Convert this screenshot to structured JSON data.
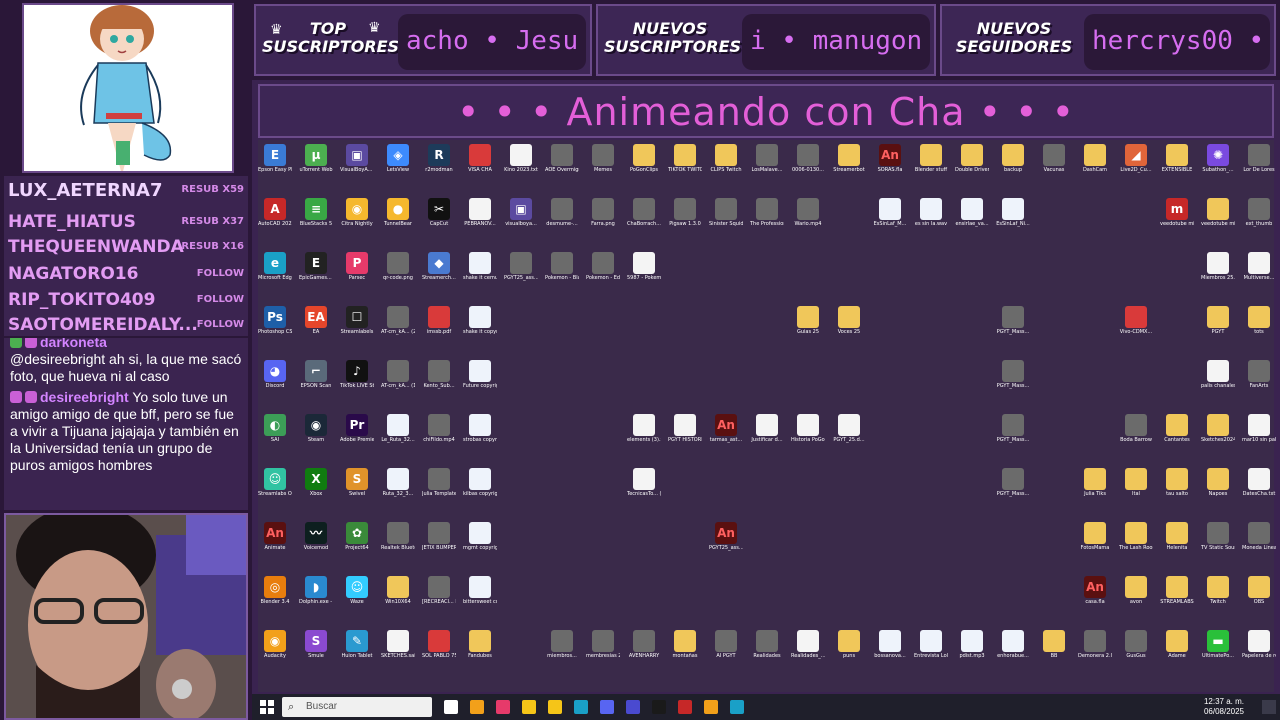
{
  "top_subscribers": {
    "title": "TOP SUSCRIPTORES",
    "ticker": "acho • Jesu"
  },
  "new_subscribers": {
    "title": "NUEVOS SUSCRIPTORES",
    "ticker": "i • manugon"
  },
  "new_followers": {
    "title": "NUEVOS SEGUIDORES",
    "ticker": "hercrys00 •"
  },
  "banner": {
    "title": "• • • Animeando con Cha • • •"
  },
  "subs": [
    {
      "name": "LUX_AETERNA7",
      "tag": "RESUB X59"
    },
    {
      "name": "HATE_HIATUS",
      "tag": "RESUB X37"
    },
    {
      "name": "THEQUEENWANDA",
      "tag": "RESUB X16"
    },
    {
      "name": "NAGATORO16",
      "tag": "FOLLOW"
    },
    {
      "name": "RIP_TOKITO409",
      "tag": "FOLLOW"
    },
    {
      "name": "SAOTOMEREIDALY...",
      "tag": "FOLLOW"
    }
  ],
  "chat": [
    {
      "user": "darkoneta",
      "text": ""
    },
    {
      "user": "",
      "text": "@desireebright ah si, la que me sacó foto, que hueva ni al caso"
    },
    {
      "user": "desireebright",
      "text": "Yo solo tuve un amigo amigo de que bff, pero se fue a vivir a Tijuana jajajaja y también en la Universidad tenía un grupo de puros amigos hombres"
    }
  ],
  "desktop": {
    "icons": [
      {
        "label": "Epson Easy Photo Print",
        "kind": "app",
        "color": "#3a7bd5",
        "glyph": "E"
      },
      {
        "label": "uTorrent Web",
        "kind": "app",
        "color": "#4caf50",
        "glyph": "µ"
      },
      {
        "label": "VisualBoyA... - Acceso di...",
        "kind": "app",
        "color": "#5b4aa0",
        "glyph": "▣"
      },
      {
        "label": "LetsView",
        "kind": "app",
        "color": "#3d8bfd",
        "glyph": "◈"
      },
      {
        "label": "r2modman",
        "kind": "app",
        "color": "#1d3b5a",
        "glyph": "R"
      },
      {
        "label": "VISA CHA",
        "kind": "doc-pdf",
        "color": "",
        "glyph": ""
      },
      {
        "label": "Kino 2023.txt",
        "kind": "doc",
        "color": "",
        "glyph": ""
      },
      {
        "label": "AOE Overmign_...",
        "kind": "pic",
        "color": "",
        "glyph": ""
      },
      {
        "label": "Memes",
        "kind": "pic",
        "color": "",
        "glyph": ""
      },
      {
        "label": "PoGonClips",
        "kind": "folder",
        "color": "",
        "glyph": ""
      },
      {
        "label": "TIKTOK TWITCH",
        "kind": "folder",
        "color": "",
        "glyph": ""
      },
      {
        "label": "CLIPS Twitch",
        "kind": "folder",
        "color": "",
        "glyph": ""
      },
      {
        "label": "LosMalave...",
        "kind": "pic",
        "color": "",
        "glyph": ""
      },
      {
        "label": "0006-0130...",
        "kind": "pic",
        "color": "",
        "glyph": ""
      },
      {
        "label": "Streamerbot",
        "kind": "folder",
        "color": "",
        "glyph": ""
      },
      {
        "label": "SORAS.fla",
        "kind": "an",
        "color": "",
        "glyph": "An"
      },
      {
        "label": "Blender stuff",
        "kind": "folder",
        "color": "",
        "glyph": ""
      },
      {
        "label": "Double Driver",
        "kind": "folder",
        "color": "",
        "glyph": ""
      },
      {
        "label": "backup",
        "kind": "folder",
        "color": "",
        "glyph": ""
      },
      {
        "label": "Vacunas",
        "kind": "pic",
        "color": "",
        "glyph": ""
      },
      {
        "label": "DashCam",
        "kind": "folder",
        "color": "",
        "glyph": ""
      },
      {
        "label": "Live2D_Cu...",
        "kind": "app",
        "color": "#e0653a",
        "glyph": "◢"
      },
      {
        "label": "EXTENSIBLE",
        "kind": "folder",
        "color": "",
        "glyph": ""
      },
      {
        "label": "Subathon_...",
        "kind": "app",
        "color": "#7a4ae0",
        "glyph": "✺"
      },
      {
        "label": "Lor De Lores",
        "kind": "pic",
        "color": "",
        "glyph": ""
      },
      {
        "label": "AutoCAD 2022 - E...",
        "kind": "app",
        "color": "#c62828",
        "glyph": "A"
      },
      {
        "label": "BlueStacks 5",
        "kind": "app",
        "color": "#39a845",
        "glyph": "≡"
      },
      {
        "label": "Citra Nightly",
        "kind": "app",
        "color": "#f5b82e",
        "glyph": "◉"
      },
      {
        "label": "TunnelBear",
        "kind": "app",
        "color": "#f5b82e",
        "glyph": "●"
      },
      {
        "label": "CapCut",
        "kind": "app",
        "color": "#111111",
        "glyph": "✂"
      },
      {
        "label": "PEBRANOV...",
        "kind": "doc",
        "color": "",
        "glyph": ""
      },
      {
        "label": "visualboya...",
        "kind": "app",
        "color": "#5b4aa0",
        "glyph": "▣"
      },
      {
        "label": "desmume-...",
        "kind": "pic",
        "color": "",
        "glyph": ""
      },
      {
        "label": "Farra.png",
        "kind": "pic",
        "color": "",
        "glyph": ""
      },
      {
        "label": "ChaBorrach...",
        "kind": "pic",
        "color": "",
        "glyph": ""
      },
      {
        "label": "Pigsaw 1.3.0",
        "kind": "pic",
        "color": "",
        "glyph": ""
      },
      {
        "label": "Sinister Squidwa...",
        "kind": "pic",
        "color": "",
        "glyph": ""
      },
      {
        "label": "The Professional",
        "kind": "pic",
        "color": "",
        "glyph": ""
      },
      {
        "label": "Wario.mp4",
        "kind": "pic",
        "color": "",
        "glyph": ""
      },
      {
        "label": "EsSinLaf_M...",
        "kind": "mp3",
        "color": "",
        "glyph": ""
      },
      {
        "label": "es sin la.wav",
        "kind": "mp3",
        "color": "",
        "glyph": ""
      },
      {
        "label": "ensirlae_va...",
        "kind": "mp3",
        "color": "",
        "glyph": ""
      },
      {
        "label": "EsSinLaf_Ni...",
        "kind": "mp3",
        "color": "",
        "glyph": ""
      },
      {
        "label": "veedotube mini-exe...",
        "kind": "app",
        "color": "#c62828",
        "glyph": "m"
      },
      {
        "label": "veedotube mini",
        "kind": "folder",
        "color": "",
        "glyph": ""
      },
      {
        "label": "ext_thumb",
        "kind": "pic",
        "color": "",
        "glyph": ""
      },
      {
        "label": "Microsoft Edge",
        "kind": "app",
        "color": "#1aa0c7",
        "glyph": "e"
      },
      {
        "label": "EpicGames... - Acceso di...",
        "kind": "app",
        "color": "#222222",
        "glyph": "E"
      },
      {
        "label": "Parsec",
        "kind": "app",
        "color": "#e63a6a",
        "glyph": "P"
      },
      {
        "label": "qr-code.png",
        "kind": "pic",
        "color": "",
        "glyph": ""
      },
      {
        "label": "Streamerch... - Acceso di...",
        "kind": "app",
        "color": "#4a7ad0",
        "glyph": "◆"
      },
      {
        "label": "shake it cemunado...",
        "kind": "mp3",
        "color": "",
        "glyph": ""
      },
      {
        "label": "PGYT25_ass...",
        "kind": "pic",
        "color": "",
        "glyph": ""
      },
      {
        "label": "Pokemon - Black Versi...",
        "kind": "pic",
        "color": "",
        "glyph": ""
      },
      {
        "label": "Pokemon - Edicion Ne...",
        "kind": "pic",
        "color": "",
        "glyph": ""
      },
      {
        "label": "5987 - Pokemon - ...",
        "kind": "doc",
        "color": "",
        "glyph": ""
      },
      {
        "label": "Miembros 25.txt",
        "kind": "doc",
        "color": "",
        "glyph": ""
      },
      {
        "label": "Multiverse...",
        "kind": "doc",
        "color": "",
        "glyph": ""
      },
      {
        "label": "Photoshop CS5",
        "kind": "app",
        "color": "#1e5fa8",
        "glyph": "Ps"
      },
      {
        "label": "EA",
        "kind": "app",
        "color": "#e5462b",
        "glyph": "EA"
      },
      {
        "label": "Streamlabels",
        "kind": "app",
        "color": "#222222",
        "glyph": "☐"
      },
      {
        "label": "AT-cm_kA... (2).mp4",
        "kind": "pic",
        "color": "",
        "glyph": ""
      },
      {
        "label": "imssb.pdf",
        "kind": "doc-pdf",
        "color": "",
        "glyph": ""
      },
      {
        "label": "shake it copyrig...",
        "kind": "mp3",
        "color": "",
        "glyph": ""
      },
      {
        "label": "Guias 25",
        "kind": "folder",
        "color": "",
        "glyph": ""
      },
      {
        "label": "Voces 25",
        "kind": "folder",
        "color": "",
        "glyph": ""
      },
      {
        "label": "PGYT_Mass...",
        "kind": "pic",
        "color": "",
        "glyph": ""
      },
      {
        "label": "Vivo-CDMX...",
        "kind": "doc-pdf",
        "color": "",
        "glyph": ""
      },
      {
        "label": "PGYT",
        "kind": "folder",
        "color": "",
        "glyph": ""
      },
      {
        "label": "tots",
        "kind": "folder",
        "color": "",
        "glyph": ""
      },
      {
        "label": "Discord",
        "kind": "app",
        "color": "#5865f2",
        "glyph": "◕"
      },
      {
        "label": "EPSON Scan",
        "kind": "app",
        "color": "#5a6a7a",
        "glyph": "⌐"
      },
      {
        "label": "TikTok LIVE Studio",
        "kind": "app",
        "color": "#111111",
        "glyph": "♪"
      },
      {
        "label": "AT-cm_kA... (1).mp4",
        "kind": "pic",
        "color": "",
        "glyph": ""
      },
      {
        "label": "Kento_Sub...",
        "kind": "pic",
        "color": "",
        "glyph": ""
      },
      {
        "label": "Future copyrig...",
        "kind": "mp3",
        "color": "",
        "glyph": ""
      },
      {
        "label": "PGYT_Mass...",
        "kind": "pic",
        "color": "",
        "glyph": ""
      },
      {
        "label": "palis chanales.txt",
        "kind": "doc",
        "color": "",
        "glyph": ""
      },
      {
        "label": "FanArts",
        "kind": "pic",
        "color": "",
        "glyph": ""
      },
      {
        "label": "SAI",
        "kind": "app",
        "color": "#3c9e57",
        "glyph": "◐"
      },
      {
        "label": "Steam",
        "kind": "app",
        "color": "#1b2838",
        "glyph": "◉"
      },
      {
        "label": "Adobe Premiere P...",
        "kind": "app",
        "color": "#2a0a4a",
        "glyph": "Pr"
      },
      {
        "label": "Le_Ruta_32...",
        "kind": "mp3",
        "color": "",
        "glyph": ""
      },
      {
        "label": "chiFildo.mp4",
        "kind": "pic",
        "color": "",
        "glyph": ""
      },
      {
        "label": "strobas copyrig...",
        "kind": "mp3",
        "color": "",
        "glyph": ""
      },
      {
        "label": "elements (3).xlsx",
        "kind": "doc",
        "color": "",
        "glyph": ""
      },
      {
        "label": "PGYT HISTORIA.txt",
        "kind": "doc",
        "color": "",
        "glyph": ""
      },
      {
        "label": "tarmas_ast...",
        "kind": "an",
        "color": "",
        "glyph": "An"
      },
      {
        "label": "Justificar d...",
        "kind": "doc",
        "color": "",
        "glyph": ""
      },
      {
        "label": "Historia PoGon.docx",
        "kind": "doc",
        "color": "",
        "glyph": ""
      },
      {
        "label": "PGYT_25.d...",
        "kind": "doc",
        "color": "",
        "glyph": ""
      },
      {
        "label": "PGYT_Mass...",
        "kind": "pic",
        "color": "",
        "glyph": ""
      },
      {
        "label": "Boda Barrow",
        "kind": "pic",
        "color": "",
        "glyph": ""
      },
      {
        "label": "Cantantes",
        "kind": "folder",
        "color": "",
        "glyph": ""
      },
      {
        "label": "Sketches2024",
        "kind": "folder",
        "color": "",
        "glyph": ""
      },
      {
        "label": "mar10 sin palabras.txt",
        "kind": "doc",
        "color": "",
        "glyph": ""
      },
      {
        "label": "Streamlabs OBS",
        "kind": "app",
        "color": "#31c3a2",
        "glyph": "☺"
      },
      {
        "label": "Xbox",
        "kind": "app",
        "color": "#107c10",
        "glyph": "X"
      },
      {
        "label": "Swivel",
        "kind": "app",
        "color": "#e0932a",
        "glyph": "S"
      },
      {
        "label": "Ruta_32_3...",
        "kind": "mp3",
        "color": "",
        "glyph": ""
      },
      {
        "label": "Julia Template...",
        "kind": "pic",
        "color": "",
        "glyph": ""
      },
      {
        "label": "kilbas copyrig...",
        "kind": "mp3",
        "color": "",
        "glyph": ""
      },
      {
        "label": "TecnicasTo... (3).xlsx",
        "kind": "doc",
        "color": "",
        "glyph": ""
      },
      {
        "label": "PGYT_Mass...",
        "kind": "pic",
        "color": "",
        "glyph": ""
      },
      {
        "label": "Julia Tiks",
        "kind": "folder",
        "color": "",
        "glyph": ""
      },
      {
        "label": "Ital",
        "kind": "folder",
        "color": "",
        "glyph": ""
      },
      {
        "label": "tau salto",
        "kind": "folder",
        "color": "",
        "glyph": ""
      },
      {
        "label": "Napoes",
        "kind": "folder",
        "color": "",
        "glyph": ""
      },
      {
        "label": "DatesCha.txt",
        "kind": "doc",
        "color": "",
        "glyph": ""
      },
      {
        "label": "Animate",
        "kind": "an",
        "color": "",
        "glyph": "An"
      },
      {
        "label": "Voicemod",
        "kind": "app",
        "color": "#0d1f1f",
        "glyph": "〰"
      },
      {
        "label": "Project64",
        "kind": "app",
        "color": "#3a8a3a",
        "glyph": "✿"
      },
      {
        "label": "Realtek Bluetooth S...",
        "kind": "pic",
        "color": "",
        "glyph": ""
      },
      {
        "label": "JETIX BUMPER - L...",
        "kind": "pic",
        "color": "",
        "glyph": ""
      },
      {
        "label": "mgmt copyrig...",
        "kind": "mp3",
        "color": "",
        "glyph": ""
      },
      {
        "label": "PGYT25_ass...",
        "kind": "an",
        "color": "",
        "glyph": "An"
      },
      {
        "label": "FotosMama",
        "kind": "folder",
        "color": "",
        "glyph": ""
      },
      {
        "label": "The Lash Room",
        "kind": "folder",
        "color": "",
        "glyph": ""
      },
      {
        "label": "Helenita",
        "kind": "folder",
        "color": "",
        "glyph": ""
      },
      {
        "label": "TV Static Sound Effe...",
        "kind": "pic",
        "color": "",
        "glyph": ""
      },
      {
        "label": "Moneda Linea.png",
        "kind": "pic",
        "color": "",
        "glyph": ""
      },
      {
        "label": "Blender 3.4",
        "kind": "app",
        "color": "#e87d0d",
        "glyph": "◎"
      },
      {
        "label": "Dolphin.exe - Acceso dire...",
        "kind": "app",
        "color": "#2a8ad0",
        "glyph": "◗"
      },
      {
        "label": "Waze",
        "kind": "app",
        "color": "#33ccff",
        "glyph": "☺"
      },
      {
        "label": "Win10X64",
        "kind": "folder",
        "color": "",
        "glyph": ""
      },
      {
        "label": "[RECREACI... Lineup - JE...",
        "kind": "pic",
        "color": "",
        "glyph": ""
      },
      {
        "label": "bittersweet copyrig...",
        "kind": "mp3",
        "color": "",
        "glyph": ""
      },
      {
        "label": "casa.fla",
        "kind": "an",
        "color": "",
        "glyph": "An"
      },
      {
        "label": "avon",
        "kind": "folder",
        "color": "",
        "glyph": ""
      },
      {
        "label": "STREAMLABS",
        "kind": "folder",
        "color": "",
        "glyph": ""
      },
      {
        "label": "Twitch",
        "kind": "folder",
        "color": "",
        "glyph": ""
      },
      {
        "label": "OBS",
        "kind": "folder",
        "color": "",
        "glyph": ""
      },
      {
        "label": "Audacity",
        "kind": "app",
        "color": "#f2a01a",
        "glyph": "◉"
      },
      {
        "label": "Smule",
        "kind": "app",
        "color": "#8a4ad0",
        "glyph": "S"
      },
      {
        "label": "Huion Tablet",
        "kind": "app",
        "color": "#2a9ad0",
        "glyph": "✎"
      },
      {
        "label": "SKETCHES.sai",
        "kind": "doc",
        "color": "",
        "glyph": ""
      },
      {
        "label": "SOL PABLO 7522 CTE H...",
        "kind": "doc-pdf",
        "color": "",
        "glyph": ""
      },
      {
        "label": "Fandubes",
        "kind": "folder",
        "color": "",
        "glyph": ""
      },
      {
        "label": "miembros...",
        "kind": "pic",
        "color": "",
        "glyph": ""
      },
      {
        "label": "membresias 2.png",
        "kind": "pic",
        "color": "",
        "glyph": ""
      },
      {
        "label": "AVENHARRY",
        "kind": "pic",
        "color": "",
        "glyph": ""
      },
      {
        "label": "montañas",
        "kind": "folder",
        "color": "",
        "glyph": ""
      },
      {
        "label": "AI PGYT",
        "kind": "pic",
        "color": "",
        "glyph": ""
      },
      {
        "label": "Realidades",
        "kind": "pic",
        "color": "",
        "glyph": ""
      },
      {
        "label": "Realidades_...",
        "kind": "doc",
        "color": "",
        "glyph": ""
      },
      {
        "label": "puns",
        "kind": "folder",
        "color": "",
        "glyph": ""
      },
      {
        "label": "bossanova...",
        "kind": "mp3",
        "color": "",
        "glyph": ""
      },
      {
        "label": "Entrevista Lola.mp3",
        "kind": "mp3",
        "color": "",
        "glyph": ""
      },
      {
        "label": "pdist.mp3",
        "kind": "mp3",
        "color": "",
        "glyph": ""
      },
      {
        "label": "enhorabue...",
        "kind": "mp3",
        "color": "",
        "glyph": ""
      },
      {
        "label": "BB",
        "kind": "folder",
        "color": "",
        "glyph": ""
      },
      {
        "label": "Demonera 2.0",
        "kind": "pic",
        "color": "",
        "glyph": ""
      },
      {
        "label": "GusGus",
        "kind": "pic",
        "color": "",
        "glyph": ""
      },
      {
        "label": "Adame",
        "kind": "folder",
        "color": "",
        "glyph": ""
      },
      {
        "label": "UltimatePo...",
        "kind": "app",
        "color": "#2ac03a",
        "glyph": "▬"
      },
      {
        "label": "Papelera de reciclaje",
        "kind": "doc",
        "color": "",
        "glyph": ""
      }
    ]
  },
  "taskbar": {
    "search_placeholder": "Buscar",
    "time": "12:37 a. m.",
    "date": "06/08/2025"
  }
}
